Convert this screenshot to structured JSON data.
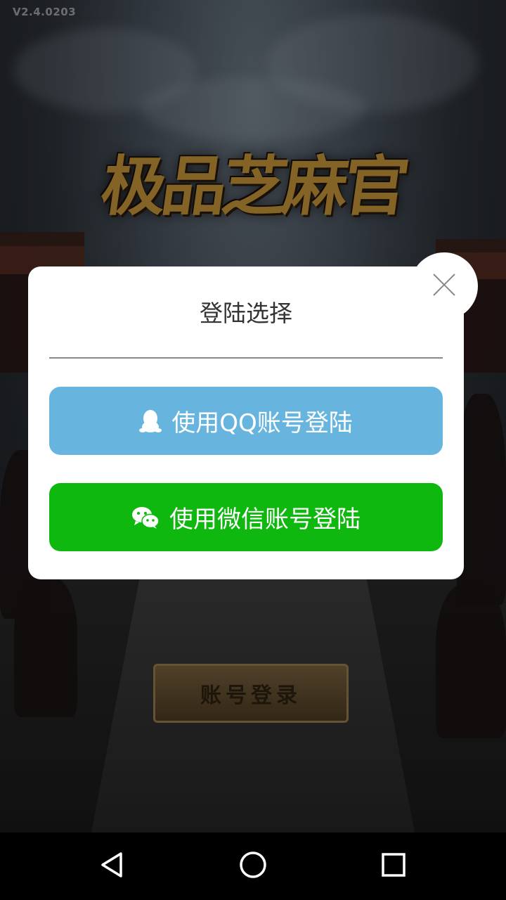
{
  "app": {
    "version": "V2.4.0203",
    "logo_text": "极品芝麻官",
    "account_login_label": "账号登录"
  },
  "dialog": {
    "title": "登陆选择",
    "qq_button_label": "使用QQ账号登陆",
    "wechat_button_label": "使用微信账号登陆",
    "close_icon": "close-icon"
  },
  "navbar": {
    "back_icon": "back-triangle-icon",
    "home_icon": "home-circle-icon",
    "recents_icon": "recents-square-icon"
  },
  "colors": {
    "qq_blue": "#67b5de",
    "wechat_green": "#0fb80f",
    "dialog_bg": "#ffffff"
  }
}
